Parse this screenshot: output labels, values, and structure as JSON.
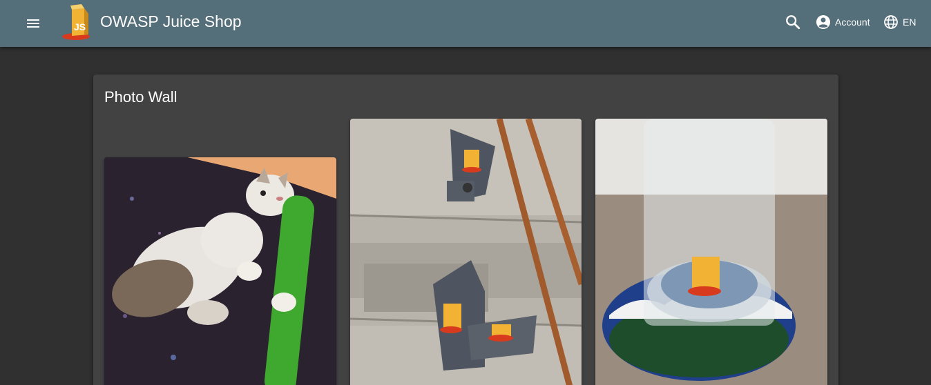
{
  "header": {
    "app_title": "OWASP Juice Shop",
    "account_label": "Account",
    "language_label": "EN",
    "colors": {
      "toolbar": "#546e7a",
      "background": "#303030",
      "card": "#424242"
    }
  },
  "icons": {
    "menu": "menu-icon",
    "search": "search-icon",
    "account": "account-circle-icon",
    "language": "globe-icon"
  },
  "photo_wall": {
    "title": "Photo Wall",
    "photos": [
      {
        "subject": "cat-with-green-toy"
      },
      {
        "subject": "juice-shop-stickers-on-metal-brackets"
      },
      {
        "subject": "glass-on-juice-shop-coaster"
      }
    ]
  }
}
